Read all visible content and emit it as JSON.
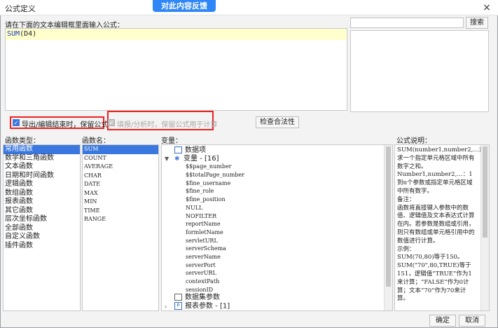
{
  "window": {
    "title": "公式定义",
    "close": "×"
  },
  "feedback": "对此内容反馈",
  "editor": {
    "prompt": "请在下面的文本编辑框里面输入公式：",
    "formula_fn": "SUM",
    "formula_arg": "(D4)"
  },
  "search": {
    "value": "",
    "button": "搜索"
  },
  "options": {
    "export_keep": "导出/编辑结束时，保留公式",
    "fill_keep": "填报/分析时，保留公式用于计算",
    "check_button": "检查合法性"
  },
  "func_type": {
    "label": "函数类型：",
    "items": [
      "常用函数",
      "数学和三角函数",
      "文本函数",
      "日期和时间函数",
      "逻辑函数",
      "数组函数",
      "报表函数",
      "其它函数",
      "层次坐标函数",
      "全部函数",
      "自定义函数",
      "插件函数"
    ]
  },
  "func_name": {
    "label": "函数名：",
    "items": [
      "SUM",
      "COUNT",
      "AVERAGE",
      "CHAR",
      "DATE",
      "MAX",
      "MIN",
      "TIME",
      "RANGE"
    ]
  },
  "variables": {
    "label": "变量：",
    "dataset": "数据项",
    "var_group": "变量 - [16]",
    "vars": [
      "$$page_number",
      "$$totalPage_number",
      "$fine_username",
      "$fine_role",
      "$fine_position",
      "NULL",
      "NOFILTER",
      "reportName",
      "formletName",
      "servletURL",
      "serverSchema",
      "serverName",
      "serverPort",
      "serverURL",
      "contextPath",
      "sessionID"
    ],
    "dataset_param": "数据集参数",
    "report_param": "报表参数 - [1]"
  },
  "description": {
    "label": "公式说明：",
    "lines": [
      "SUM(number1,number2,…)：求一个指定单元格区域中所有数字之和。",
      "Number1,number2,…：1到n个参数或指定单元格区域中所有数字。",
      "备注：",
      "函数将直接键入参数中的数值、逻辑值及文本表达式计算在内。若参数是数组或引用，则只有数组或单元格引用中的数值进行计算。",
      "示例：",
      "SUM(70,80)等于150。",
      "SUM(\"70\",80,TRUE)等于151，逻辑值“TRUE”作为1来计算；“FALSE”作为0计算；文本“70”作为70来计算。"
    ]
  },
  "buttons": {
    "ok": "确定",
    "cancel": "取消"
  }
}
